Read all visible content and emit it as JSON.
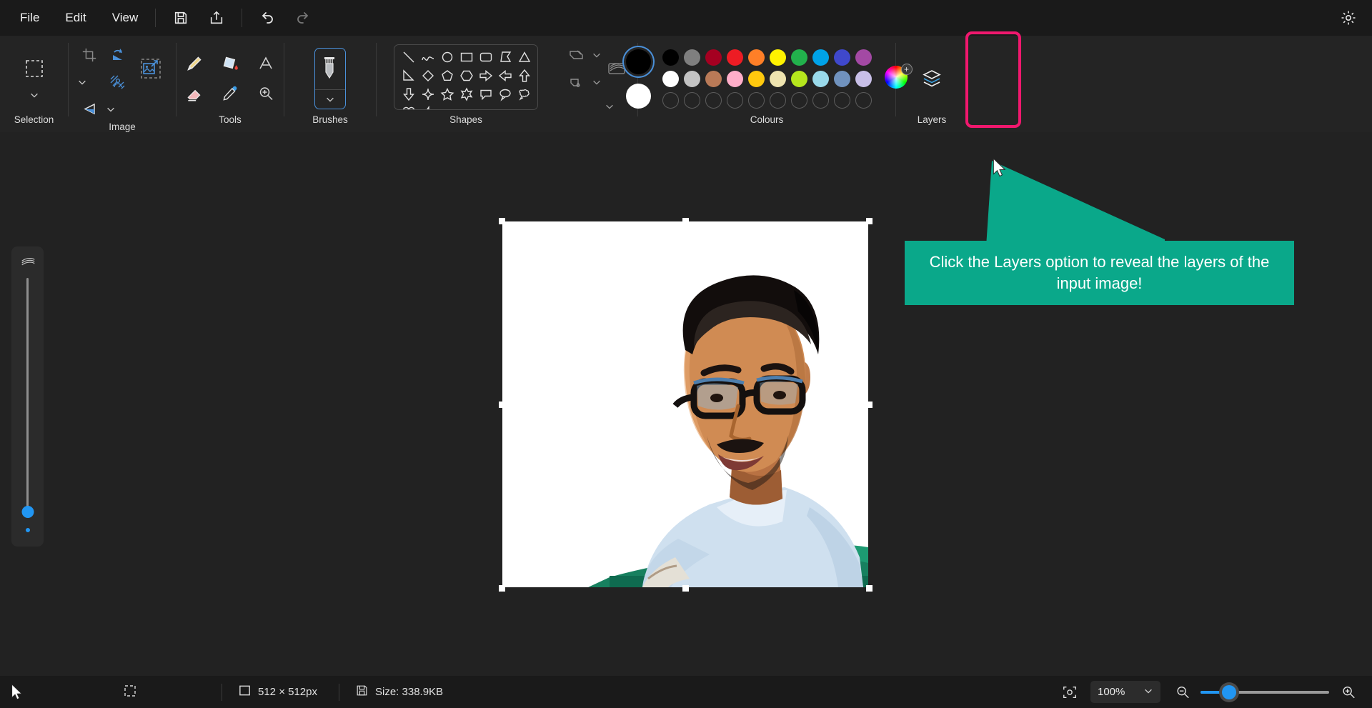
{
  "app": {
    "title": "Paint Image Editor",
    "bg_color": "#1e1e1e",
    "accent_color": "#2196f3",
    "highlight_color": "#f0186e",
    "callout_color": "#0aa88a"
  },
  "menubar": {
    "items": [
      {
        "label": "File",
        "name": "menu-file"
      },
      {
        "label": "Edit",
        "name": "menu-edit"
      },
      {
        "label": "View",
        "name": "menu-view"
      }
    ],
    "icons": [
      {
        "name": "save-icon",
        "label": "Save"
      },
      {
        "name": "share-icon",
        "label": "Share"
      },
      {
        "name": "undo-icon",
        "label": "Undo"
      },
      {
        "name": "redo-icon",
        "label": "Redo"
      }
    ],
    "settings_icon": "gear-icon"
  },
  "ribbon": {
    "groups": [
      {
        "label": "Selection",
        "name": "group-selection"
      },
      {
        "label": "Image",
        "name": "group-image"
      },
      {
        "label": "Tools",
        "name": "group-tools"
      },
      {
        "label": "Brushes",
        "name": "group-brushes"
      },
      {
        "label": "Shapes",
        "name": "group-shapes"
      },
      {
        "label": "Colours",
        "name": "group-colours"
      },
      {
        "label": "Layers",
        "name": "group-layers"
      }
    ],
    "selection": {
      "tool": "rectangular-select-icon",
      "dropdown": "chevron-down-icon"
    },
    "image": {
      "crop": "crop-icon",
      "rotate": "rotate-icon",
      "rotate_dropdown": "chevron-down-icon",
      "flip": "flip-icon",
      "flip_dropdown": "chevron-down-icon",
      "background_removal": "background-removal-icon",
      "resize": "resize-image-icon"
    },
    "tools": [
      "pencil-icon",
      "fill-bucket-icon",
      "text-icon",
      "eraser-icon",
      "colour-picker-icon",
      "magnifier-icon"
    ],
    "brushes": {
      "current": "brush-icon",
      "dropdown": "chevron-down-icon"
    },
    "shapes": [
      "line",
      "curve",
      "oval",
      "rectangle",
      "rounded-rectangle",
      "polygon",
      "triangle",
      "right-triangle",
      "diamond",
      "pentagon",
      "hexagon",
      "right-arrow",
      "left-arrow",
      "up-arrow",
      "down-arrow",
      "four-point-star",
      "five-point-star",
      "six-point-star",
      "rounded-callout",
      "oval-callout",
      "cloud-callout",
      "heart",
      "lightning"
    ],
    "shape_tools": {
      "outline": "shape-outline-icon",
      "outline_dropdown": "chevron-down-icon",
      "fill": "shape-fill-icon",
      "fill_dropdown": "chevron-down-icon",
      "thickness": "line-thickness-icon",
      "thickness_dropdown": "chevron-down-icon"
    },
    "colours": {
      "primary_swatch": "#000000",
      "secondary_swatch": "#ffffff",
      "row1": [
        "#000000",
        "#7f7f7f",
        "#a50021",
        "#ed1c24",
        "#ff7f27",
        "#fff200",
        "#22b14c",
        "#00a2e8",
        "#3f48cc",
        "#a349a4"
      ],
      "row2": [
        "#ffffff",
        "#c3c3c3",
        "#b97a57",
        "#ffaec9",
        "#ffc90e",
        "#efe4b0",
        "#b5e61d",
        "#99d9ea",
        "#7092be",
        "#c8bfe7"
      ],
      "row3": [
        "",
        "",
        "",
        "",
        "",
        "",
        "",
        "",
        "",
        ""
      ],
      "colour_wheel": "colour-wheel-icon",
      "add_colour": "plus-icon"
    },
    "layers": {
      "icon": "layers-icon",
      "label": "Layers"
    }
  },
  "canvas": {
    "zoom_slider_icon": "brush-size-icon",
    "image_alt": "Portrait of a smiling man with glasses and moustache wearing a light blue t-shirt, sitting on a green bench, on a white background"
  },
  "callout": {
    "text": "Click the Layers option to reveal the layers of the input image!",
    "cursor": "mouse-pointer-icon"
  },
  "statusbar": {
    "selection_icon": "selection-size-icon",
    "dimensions_icon": "image-dimensions-icon",
    "dimensions": "512 × 512px",
    "size_icon": "file-size-icon",
    "size": "Size: 338.9KB",
    "fit_icon": "fit-to-screen-icon",
    "zoom_level": "100%",
    "zoom_dropdown": "chevron-down-icon",
    "zoom_out_icon": "zoom-out-icon",
    "zoom_in_icon": "zoom-in-icon"
  }
}
